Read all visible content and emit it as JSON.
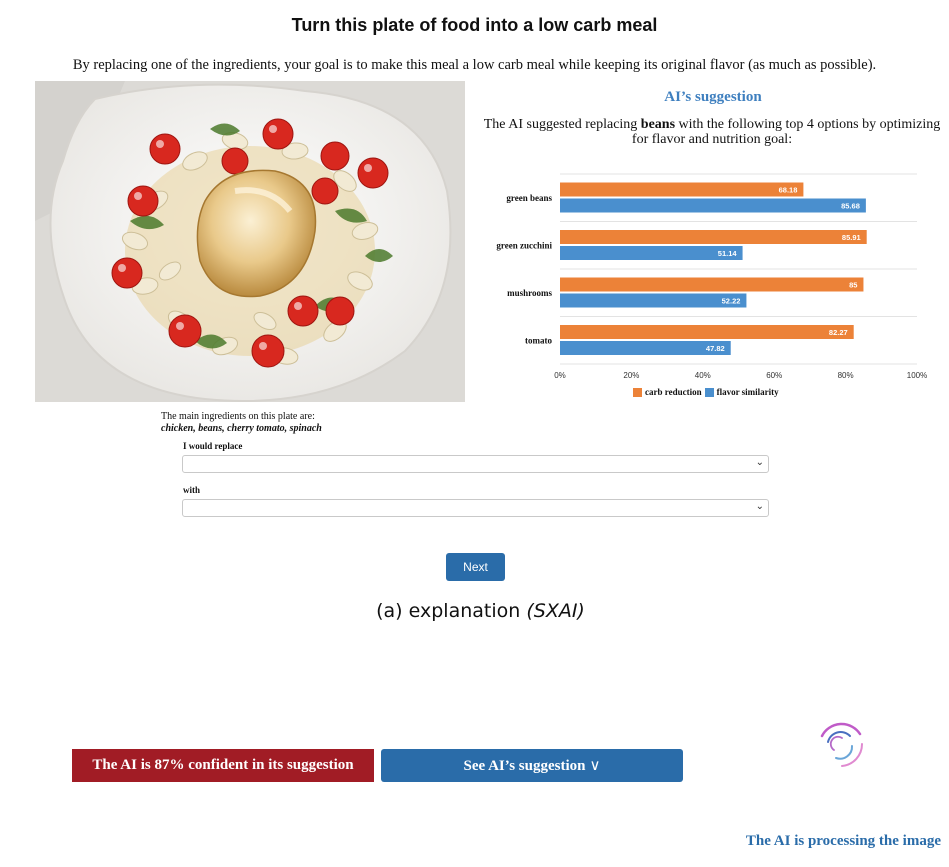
{
  "page": {
    "title": "Turn this plate of food into a low carb meal",
    "instructions": "By replacing one of the ingredients, your goal is to make this meal a low carb meal while keeping its original flavor (as much as possible)."
  },
  "ingredients": {
    "intro": "The main ingredients on this plate are:",
    "list": "chicken, beans, cherry tomato, spinach"
  },
  "form": {
    "replace_label": "I would replace",
    "replace_value": "",
    "with_label": "with",
    "with_value": "",
    "next_label": "Next"
  },
  "caption": {
    "text": "(a) explanation ",
    "emphasis": "(SXAI)"
  },
  "suggestion": {
    "heading": "AI’s suggestion",
    "text_before": "The AI suggested replacing ",
    "ingredient": "beans",
    "text_after": " with the following top 4 options by optimizing for flavor and nutrition goal:"
  },
  "chart_data": {
    "type": "bar",
    "orientation": "horizontal",
    "categories": [
      "green beans",
      "green zucchini",
      "mushrooms",
      "tomato"
    ],
    "series": [
      {
        "name": "carb reduction",
        "color": "#ec8238",
        "values": [
          68.18,
          85.91,
          85,
          82.27
        ]
      },
      {
        "name": "flavor similarity",
        "color": "#4a8fce",
        "values": [
          85.68,
          51.14,
          52.22,
          47.82
        ]
      }
    ],
    "xlim": [
      0,
      100
    ],
    "x_ticks": [
      "0%",
      "20%",
      "40%",
      "60%",
      "80%",
      "100%"
    ],
    "grid": true,
    "legend": "bottom"
  },
  "status": {
    "confidence": "The AI is 87% confident in its suggestion",
    "see_suggestion": "See AI’s suggestion",
    "chevron": "∨",
    "processing": "The AI is processing the image"
  },
  "icons": {
    "spinner": "loading-spinner-icon",
    "dropdown": "chevron-down-icon"
  },
  "colors": {
    "primary": "#2a6ca9",
    "danger": "#a11c25",
    "heading_blue": "#3e7fbf"
  }
}
